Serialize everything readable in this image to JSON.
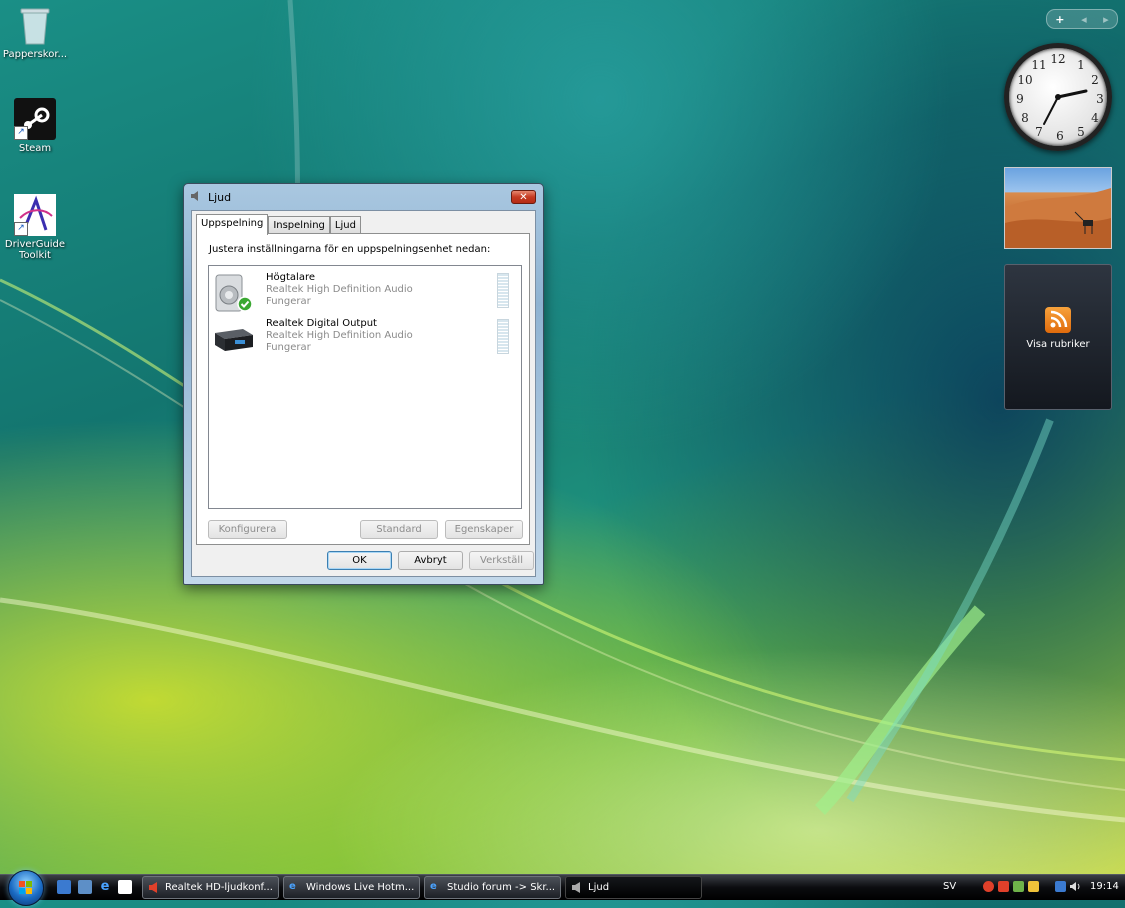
{
  "desktop": {
    "icons": [
      {
        "label": "Papperskor..."
      },
      {
        "label": "Steam"
      },
      {
        "label": "DriverGuide Toolkit"
      }
    ]
  },
  "sidebar": {
    "controls": {
      "add": "+",
      "prev": "◂",
      "next": "▸"
    },
    "clock": {
      "numbers": [
        "12",
        "1",
        "2",
        "3",
        "4",
        "5",
        "6",
        "7",
        "8",
        "9",
        "10",
        "11"
      ],
      "time": "19:14"
    },
    "feeds": {
      "label": "Visa rubriker"
    }
  },
  "dialog": {
    "title": "Ljud",
    "close": "✕",
    "tabs": [
      "Uppspelning",
      "Inspelning",
      "Ljud"
    ],
    "active_tab": "Uppspelning",
    "description": "Justera inställningarna för en uppspelningsenhet nedan:",
    "devices": [
      {
        "name": "Högtalare",
        "driver": "Realtek High Definition Audio",
        "status": "Fungerar",
        "default": true
      },
      {
        "name": "Realtek Digital Output",
        "driver": "Realtek High Definition Audio",
        "status": "Fungerar",
        "default": false
      }
    ],
    "buttons": {
      "configure": "Konfigurera",
      "set_default": "Standard",
      "properties": "Egenskaper",
      "ok": "OK",
      "cancel": "Avbryt",
      "apply": "Verkställ"
    }
  },
  "taskbar": {
    "tasks": [
      {
        "label": "Realtek HD-ljudkonf..."
      },
      {
        "label": "Windows Live Hotm..."
      },
      {
        "label": "Studio forum -> Skr..."
      },
      {
        "label": "Ljud"
      }
    ],
    "language": "SV",
    "clock": "19:14"
  },
  "colors": {
    "accent": "#1a6bc4",
    "close": "#c53a22",
    "ok_check": "#3aa832"
  }
}
